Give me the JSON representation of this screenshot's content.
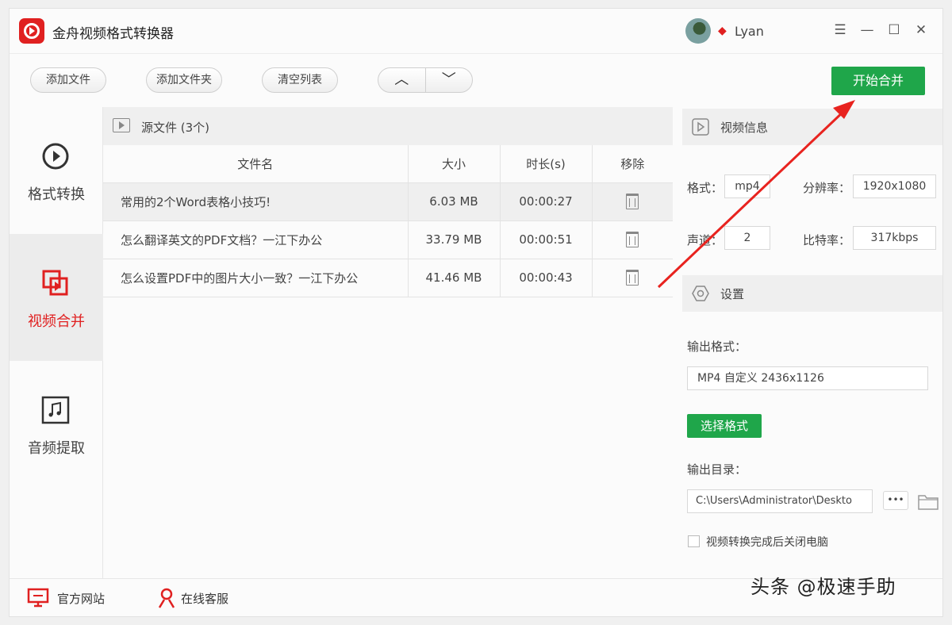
{
  "app": {
    "title": "金舟视频格式转换器",
    "username": "Lyan"
  },
  "window_controls": {
    "menu": "☰",
    "minimize": "—",
    "maximize": "☐",
    "close": "✕"
  },
  "toolbar": {
    "add_file": "添加文件",
    "add_folder": "添加文件夹",
    "clear_list": "清空列表",
    "move_up": "︿",
    "move_down": "﹀",
    "start_merge": "开始合并"
  },
  "sidebar": {
    "items": [
      {
        "label": "格式转换",
        "icon": "play-circle-icon",
        "active": false
      },
      {
        "label": "视频合并",
        "icon": "merge-squares-icon",
        "active": true
      },
      {
        "label": "音频提取",
        "icon": "music-note-icon",
        "active": false
      }
    ]
  },
  "file_list": {
    "title": "源文件 (3个)",
    "columns": [
      "文件名",
      "大小",
      "时长(s)",
      "移除"
    ],
    "rows": [
      {
        "name": "常用的2个Word表格小技巧!",
        "size": "6.03 MB",
        "duration": "00:00:27"
      },
      {
        "name": "怎么翻译英文的PDF文档？一江下办公",
        "size": "33.79 MB",
        "duration": "00:00:51"
      },
      {
        "name": "怎么设置PDF中的图片大小一致？一江下办公",
        "size": "41.46 MB",
        "duration": "00:00:43"
      }
    ]
  },
  "video_info": {
    "title": "视频信息",
    "format_label": "格式：",
    "format_value": "mp4",
    "resolution_label": "分辨率：",
    "resolution_value": "1920x1080",
    "channels_label": "声道：",
    "channels_value": "2",
    "bitrate_label": "比特率：",
    "bitrate_value": "317kbps"
  },
  "settings": {
    "title": "设置",
    "output_format_label": "输出格式：",
    "output_format_value": "MP4 自定义 2436x1126",
    "choose_format_button": "选择格式",
    "output_dir_label": "输出目录：",
    "output_dir_value": "C:\\Users\\Administrator\\Deskto",
    "browse_button": "•••",
    "shutdown_checkbox_label": "视频转换完成后关闭电脑"
  },
  "bottom": {
    "official_site": "官方网站",
    "online_support": "在线客服"
  },
  "watermark": "头条 @极速手助",
  "colors": {
    "accent_green": "#1fa64a",
    "brand_red": "#e02020",
    "arrow_red": "#e8231f"
  }
}
